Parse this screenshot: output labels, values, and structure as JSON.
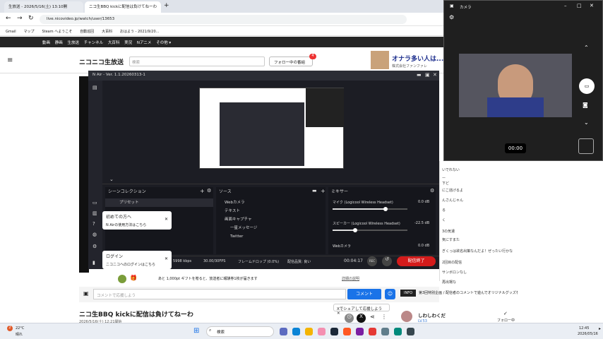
{
  "browser": {
    "tabs": [
      "生放送 - 2026/5/16(土) 13:10開",
      "ニコ生BBQ kickに配信は負けてねーわ"
    ],
    "url": "live.nicovideo.jp/watch/user/13653",
    "bookmarks": [
      "Gmail",
      "マップ",
      "Steam へようこそ",
      "自動巡回",
      "大百科",
      "おはよう - 2021/9/20..."
    ]
  },
  "nico": {
    "nav": [
      "動画",
      "静画",
      "生放送",
      "チャンネル",
      "大百科",
      "実況",
      "Nアニメ",
      "その他 ▾"
    ],
    "logo": "ニコニコ生放送",
    "search_placeholder": "検索",
    "follow_button": "フォロー中の番組",
    "badge": "4",
    "ad_title": "オナラ多い人は...",
    "ad_sub": "株式会社ファンファレ"
  },
  "nair": {
    "title": "N Air - Ver. 1.1.20260313-1",
    "scene_header": "シーンコレクション",
    "scene_item": "プリセット",
    "source_header": "ソース",
    "sources": [
      "Webカメラ",
      "テキスト",
      "画面キャプチャ",
      "一星メッセージ",
      "Twitter"
    ],
    "mixer_header": "ミキサー",
    "mixer": [
      {
        "name": "マイク (Logicool Wireless Headset)",
        "db": "0.0 dB",
        "level": 0.71
      },
      {
        "name": "スピーカー (Logicool Wireless Headset)",
        "db": "-22.5 dB",
        "level": 0.3
      },
      {
        "name": "Webカメラ",
        "db": "0.0 dB",
        "level": 0.0
      }
    ],
    "status_kbps": "5998 kbps",
    "status_fps": "30.00/30FPS",
    "status_drop": "フレームドロップ (0.0%)",
    "status_quality": "配信品質: 良い",
    "timer": "00:04:17",
    "rec_label": "REC",
    "end_label": "配信終了"
  },
  "tips": {
    "first_title": "初めての方へ",
    "first_sub": "N Airの使用方法はこちら",
    "login_title": "ログイン",
    "login_sub": "ニコニコへのログインはこちら"
  },
  "camera": {
    "title": "カメラ",
    "timer": "00:00"
  },
  "chat": [
    "いでれない",
    "ー",
    "下ど",
    "にこ逃げるよ",
    "んさんじゃん",
    "る",
    "く",
    "3の気遣",
    "気にすまた",
    "ぎくっは欲名出策なんだよ！ぜったい行かな",
    "2回目の配信",
    "サンボロンなし",
    "再出場な",
    "あれはえw"
  ],
  "gift": {
    "text": "あと 1,000pt ギフトを贈ると、放送者に報酬券1枚が届きます",
    "link": "詳細の説明"
  },
  "comment": {
    "placeholder": "コメントで応援しよう",
    "submit": "コメント",
    "banner": "INFO",
    "banner_text": "第3回特別企画 / 配信者のコメントで遊んでオリジナルグッズを手に入れた",
    "share": "Xでシェアして応援しよう"
  },
  "stream": {
    "title": "ニコ生BBQ kickに配信は負けてねーわ",
    "date": "2026/5/16(土) 12:21開始",
    "host": "しわしわくだ",
    "level": "LV.53",
    "follow": "フォロー中"
  },
  "taskbar": {
    "weather_temp": "22°C",
    "weather_desc": "晴れ",
    "weather_badge": "2",
    "search": "検索",
    "time": "12:45",
    "date": "2026/05/16"
  }
}
